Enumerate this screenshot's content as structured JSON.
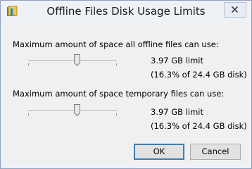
{
  "window": {
    "title": "Offline Files Disk Usage Limits"
  },
  "offline_files": {
    "label": "Maximum amount of space all offline files can use:",
    "limit_text": "3.97 GB limit",
    "percent_text": "(16.3% of 24.4 GB disk)",
    "slider_fraction": 0.55
  },
  "temporary_files": {
    "label": "Maximum amount of space temporary files can use:",
    "limit_text": "3.97 GB limit",
    "percent_text": "(16.3% of 24.4 GB disk)",
    "slider_fraction": 0.55
  },
  "buttons": {
    "ok": "OK",
    "cancel": "Cancel"
  },
  "icons": {
    "app": "offline-files-icon",
    "close": "close-icon"
  }
}
